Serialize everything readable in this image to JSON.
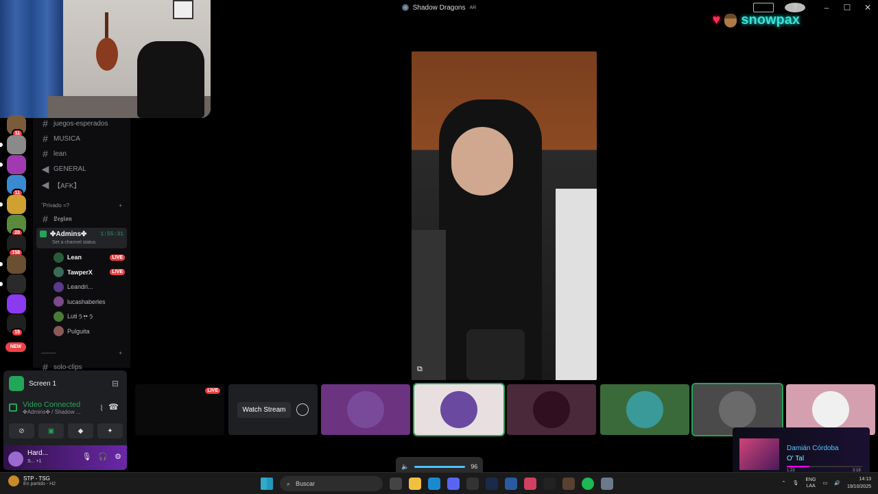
{
  "window": {
    "server": "Shadow Dragons",
    "tag": "AR"
  },
  "overlay": {
    "name": "snowpax"
  },
  "guilds": [
    {
      "badge": "11",
      "color": "#7a5c3a"
    },
    {
      "badge": "",
      "color": "#8a8a8a"
    },
    {
      "badge": "",
      "color": "#a03ab0"
    },
    {
      "badge": "11",
      "color": "#3a8ad0"
    },
    {
      "badge": "",
      "color": "#d0a030"
    },
    {
      "badge": "20",
      "color": "#5a8a3a"
    },
    {
      "badge": "158",
      "color": "#202020"
    },
    {
      "badge": "",
      "color": "#6a5030"
    },
    {
      "badge": "",
      "color": "#2a2a2a"
    },
    {
      "badge": "",
      "color": "#8a3af0"
    },
    {
      "badge": "15",
      "color": "#202020"
    },
    {
      "badge": "NEW",
      "color": "#ed4245"
    }
  ],
  "channels": {
    "text1": "juegos-esperados",
    "text2": "MUSICA",
    "text3": "lean",
    "voice1": "GENERAL",
    "voice2": "【AFK】",
    "category_private": "ˇPrivado =?",
    "legion": "𝕷𝖊𝖌𝖎𝖔𝖓",
    "category2": "--------",
    "clips": "solo-clips"
  },
  "active_voice": {
    "name": "✤Admins✤",
    "timer": "1:55:31",
    "status": "Set a channel status"
  },
  "voice_users": [
    {
      "name": "Lean",
      "live": "LIVE",
      "color": "#2a5a3a"
    },
    {
      "name": "TawperX",
      "live": "LIVE",
      "color": "#3a6a5a"
    },
    {
      "name": "Leandri...",
      "live": "",
      "color": "#5a3a8a"
    },
    {
      "name": "lucashaberles",
      "live": "",
      "color": "#7a4a8a"
    },
    {
      "name": "Lutiぅ•ฺ•ぅ",
      "live": "",
      "color": "#4a7a3a"
    },
    {
      "name": "Pulguita",
      "live": "",
      "color": "#8a5a5a"
    }
  ],
  "panel": {
    "screen": "Screen 1",
    "connected": "Video Connected",
    "location": "✤Admins✤ / Shadow ...",
    "user": "Hard...",
    "user_status": "S... +1"
  },
  "strip": {
    "live": "LIVE",
    "watch": "Watch Stream"
  },
  "tiles": [
    {
      "bg": "#6b3380",
      "av": "#7a4a9a",
      "speaking": false
    },
    {
      "bg": "#e8e0e0",
      "av": "#6a4aa0",
      "speaking": true
    },
    {
      "bg": "#4a2a3a",
      "av": "#301020",
      "speaking": false
    },
    {
      "bg": "#3a6a3a",
      "av": "#3a9a9a",
      "speaking": false
    },
    {
      "bg": "#4a4a4a",
      "av": "#6a6a6a",
      "speaking": true
    },
    {
      "bg": "#d4a0b0",
      "av": "#f0f0f0",
      "speaking": false
    }
  ],
  "music": {
    "artist": "Damián Córdoba",
    "song": "O' Tal",
    "elapsed": "1:23",
    "total": "3:18",
    "progress": 0.3
  },
  "volume": {
    "value": "96"
  },
  "taskbar": {
    "game_title": "STP - TSG",
    "game_status": "En partido - H2",
    "search": "Buscar",
    "lang1": "ENG",
    "lang2": "LAA",
    "time": "14:13",
    "date": "19/10/2025"
  }
}
